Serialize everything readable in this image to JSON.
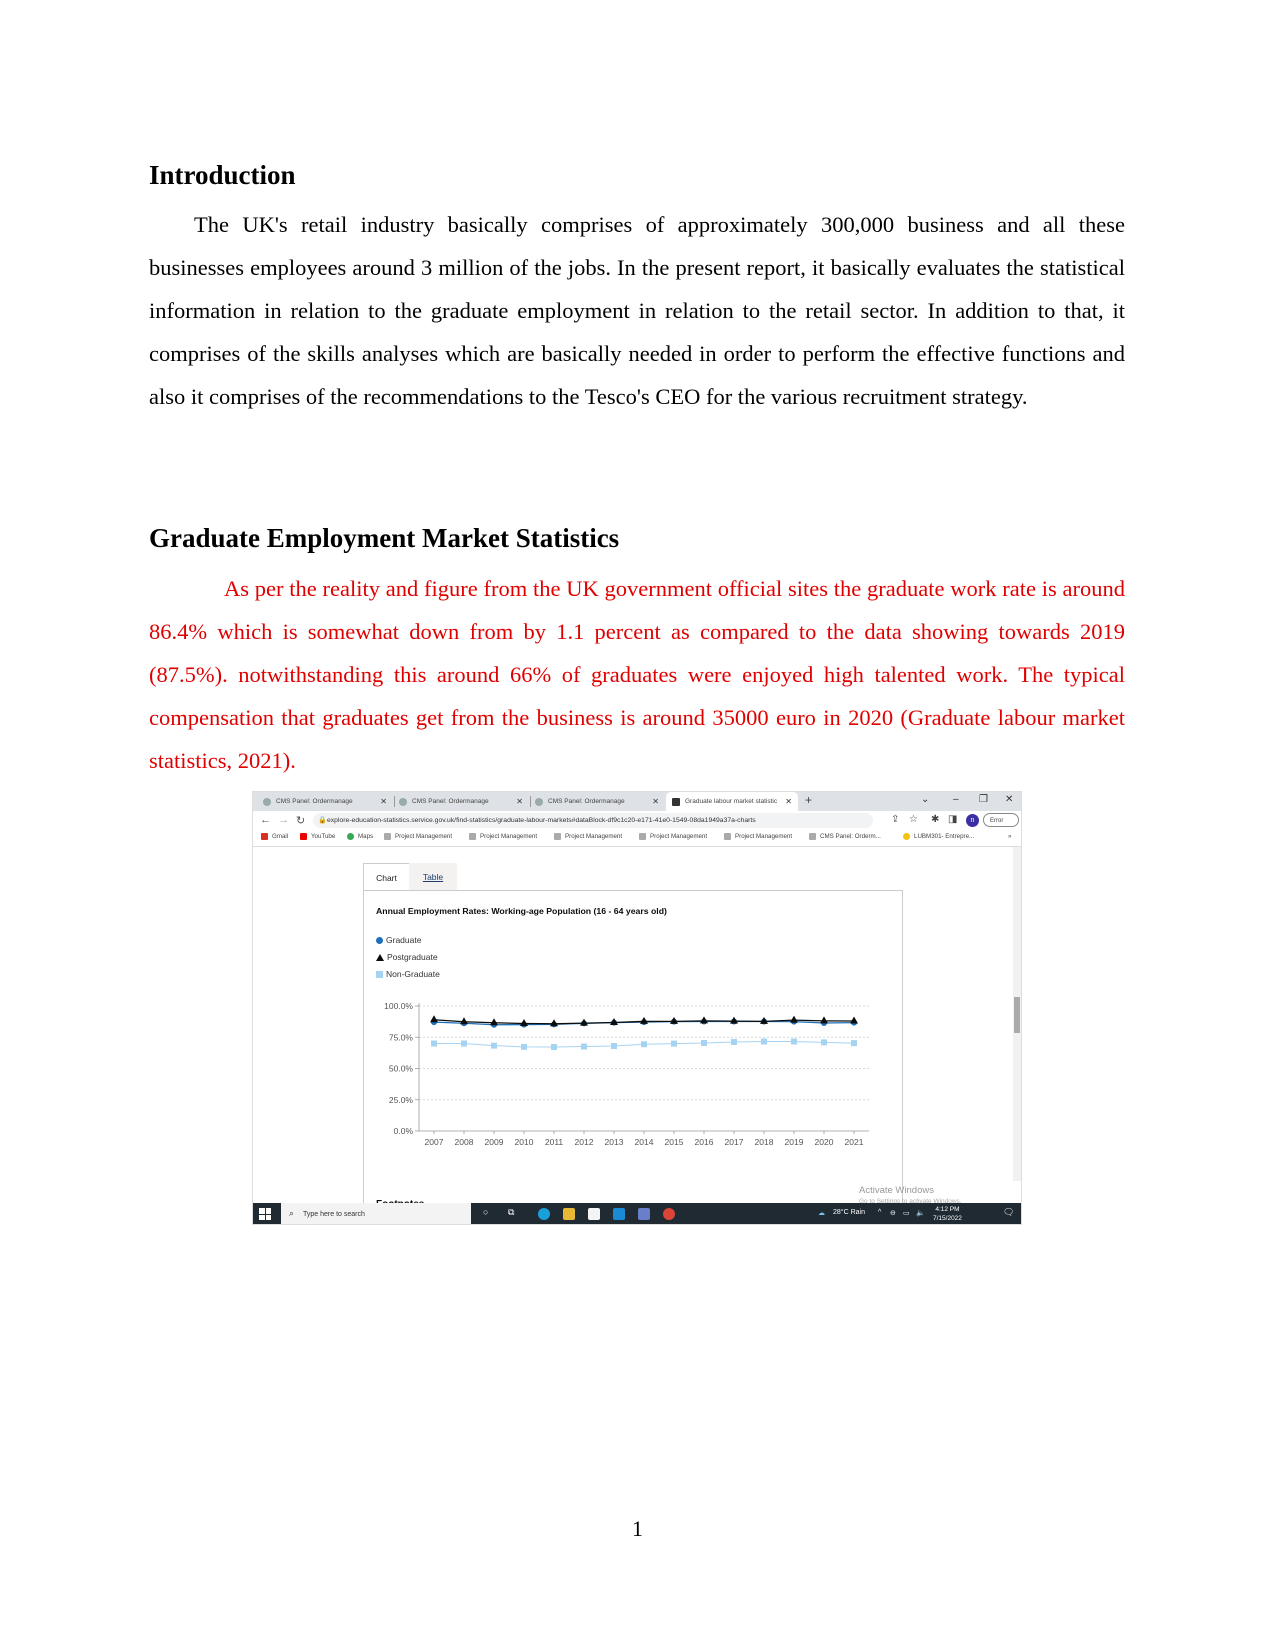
{
  "document": {
    "intro_heading": "Introduction",
    "intro_paragraph": "The UK's retail industry basically comprises of approximately 300,000 business and all these businesses employees around 3 million of the jobs. In the present report, it basically evaluates the statistical information in relation to the graduate employment in relation to the retail sector. In addition to that, it comprises of the skills analyses which are basically needed in order to perform the effective functions and also it comprises of the recommendations to the Tesco's CEO for the various recruitment strategy.",
    "stats_heading": "Graduate Employment Market Statistics",
    "stats_paragraph": "As per the reality and figure from the UK government official sites the graduate work rate is around 86.4% which is somewhat down from by 1.1 percent as compared to the data showing towards 2019 (87.5%). notwithstanding this around 66% of graduates were enjoyed high talented work. The typical compensation that graduates get from the business is around 35000 euro in 2020 (Graduate labour market statistics, 2021).",
    "stats_text_color": "#e00000",
    "page_number": "1"
  },
  "browser": {
    "tabs": [
      {
        "label": "CMS Panel: Ordermanage",
        "active": false
      },
      {
        "label": "CMS Panel: Ordermanage",
        "active": false
      },
      {
        "label": "CMS Panel: Ordermanage",
        "active": false
      },
      {
        "label": "Graduate labour market statistic",
        "active": true
      }
    ],
    "new_tab": "+",
    "url": "explore-education-statistics.service.gov.uk/find-statistics/graduate-labour-markets#dataBlock-df9c1c20-e171-41e0-1549-08da1949a37a-charts",
    "profile_initial": "n",
    "error_label": "Error",
    "bookmarks": [
      "Gmail",
      "YouTube",
      "Maps",
      "Project Management",
      "Project Management",
      "Project Management",
      "Project Management",
      "Project Management",
      "CMS Panel: Orderm...",
      "LUBM301- Entrepre..."
    ],
    "bookmarks_overflow": "»"
  },
  "page": {
    "tabs": {
      "chart": "Chart",
      "table": "Table"
    },
    "footnotes_heading": "Footnotes",
    "watermark_title": "Activate Windows",
    "watermark_sub": "Go to Settings to activate Windows."
  },
  "taskbar": {
    "search_placeholder": "Type here to search",
    "weather": "28°C  Rain",
    "time": "4:12 PM",
    "date": "7/15/2022"
  },
  "chart_data": {
    "type": "line",
    "title": "Annual Employment Rates: Working-age Population (16 - 64 years old)",
    "xlabel": "",
    "ylabel": "",
    "x": [
      "2007",
      "2008",
      "2009",
      "2010",
      "2011",
      "2012",
      "2013",
      "2014",
      "2015",
      "2016",
      "2017",
      "2018",
      "2019",
      "2020",
      "2021"
    ],
    "y_ticks": [
      "0.0%",
      "25.0%",
      "50.0%",
      "75.0%",
      "100.0%"
    ],
    "ylim": [
      0,
      100
    ],
    "grid": true,
    "legend_position": "top-left",
    "series": [
      {
        "name": "Graduate",
        "marker": "circle",
        "color": "#1d70b8",
        "values": [
          87.1,
          86.2,
          85.0,
          85.1,
          85.3,
          86.1,
          86.7,
          87.1,
          87.5,
          87.6,
          87.6,
          87.6,
          87.5,
          86.4,
          86.7
        ]
      },
      {
        "name": "Postgraduate",
        "marker": "triangle",
        "color": "#0b0c0c",
        "values": [
          89.0,
          87.4,
          86.6,
          86.0,
          85.8,
          86.3,
          86.8,
          87.7,
          87.7,
          88.1,
          87.9,
          87.7,
          88.7,
          88.1,
          88.0
        ]
      },
      {
        "name": "Non-Graduate",
        "marker": "square",
        "color": "#a7d3f2",
        "values": [
          70.0,
          70.0,
          68.3,
          67.3,
          67.2,
          67.6,
          68.0,
          69.4,
          69.9,
          70.4,
          71.2,
          71.6,
          71.6,
          70.9,
          70.3
        ]
      }
    ]
  }
}
